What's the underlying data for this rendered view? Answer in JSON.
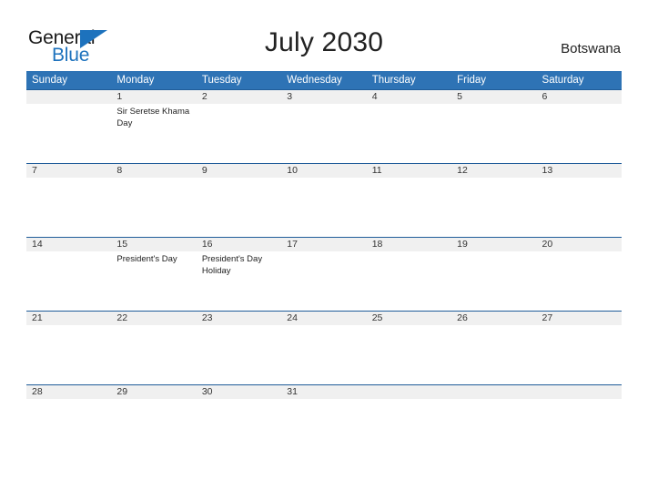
{
  "brand": {
    "name_part1": "General",
    "name_part2": "Blue",
    "mark_icon": "blue-triangle-flag-icon"
  },
  "header": {
    "title": "July 2030",
    "country": "Botswana"
  },
  "colors": {
    "header_blue": "#2e73b5",
    "row_divider_blue": "#1f5c99",
    "day_band_gray": "#f0f0f0",
    "logo_blue": "#1d72bd",
    "text_dark": "#1f1f1f",
    "page_background": "#ffffff"
  },
  "calendar": {
    "weekday_headers": [
      "Sunday",
      "Monday",
      "Tuesday",
      "Wednesday",
      "Thursday",
      "Friday",
      "Saturday"
    ],
    "weeks": [
      [
        {
          "day": "",
          "event": ""
        },
        {
          "day": "1",
          "event": "Sir Seretse Khama Day"
        },
        {
          "day": "2",
          "event": ""
        },
        {
          "day": "3",
          "event": ""
        },
        {
          "day": "4",
          "event": ""
        },
        {
          "day": "5",
          "event": ""
        },
        {
          "day": "6",
          "event": ""
        }
      ],
      [
        {
          "day": "7",
          "event": ""
        },
        {
          "day": "8",
          "event": ""
        },
        {
          "day": "9",
          "event": ""
        },
        {
          "day": "10",
          "event": ""
        },
        {
          "day": "11",
          "event": ""
        },
        {
          "day": "12",
          "event": ""
        },
        {
          "day": "13",
          "event": ""
        }
      ],
      [
        {
          "day": "14",
          "event": ""
        },
        {
          "day": "15",
          "event": "President's Day"
        },
        {
          "day": "16",
          "event": "President's Day Holiday"
        },
        {
          "day": "17",
          "event": ""
        },
        {
          "day": "18",
          "event": ""
        },
        {
          "day": "19",
          "event": ""
        },
        {
          "day": "20",
          "event": ""
        }
      ],
      [
        {
          "day": "21",
          "event": ""
        },
        {
          "day": "22",
          "event": ""
        },
        {
          "day": "23",
          "event": ""
        },
        {
          "day": "24",
          "event": ""
        },
        {
          "day": "25",
          "event": ""
        },
        {
          "day": "26",
          "event": ""
        },
        {
          "day": "27",
          "event": ""
        }
      ],
      [
        {
          "day": "28",
          "event": ""
        },
        {
          "day": "29",
          "event": ""
        },
        {
          "day": "30",
          "event": ""
        },
        {
          "day": "31",
          "event": ""
        },
        {
          "day": "",
          "event": ""
        },
        {
          "day": "",
          "event": ""
        },
        {
          "day": "",
          "event": ""
        }
      ]
    ]
  }
}
